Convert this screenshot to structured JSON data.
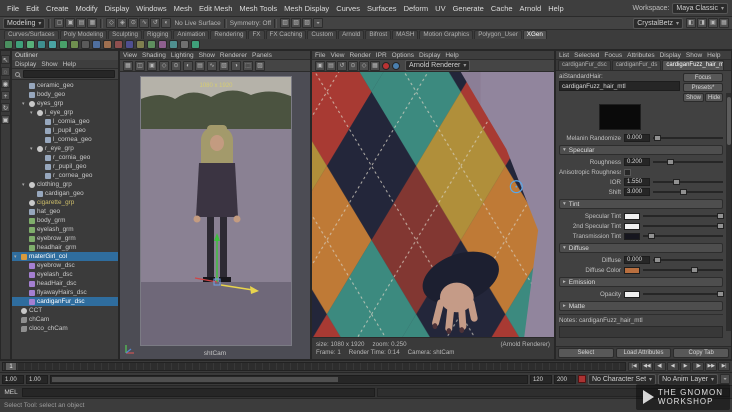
{
  "icons": {
    "caret_down": "▾",
    "caret_right": "▸"
  },
  "menubar": {
    "items": [
      "File",
      "Edit",
      "Create",
      "Modify",
      "Display",
      "Windows",
      "Mesh",
      "Edit Mesh",
      "Mesh Tools",
      "Mesh Display",
      "Curves",
      "Surfaces",
      "Deform",
      "UV",
      "Generate",
      "Cache",
      "Arnold",
      "Help"
    ],
    "workspace_label": "Workspace:",
    "workspace_value": "Maya Classic"
  },
  "statusline": {
    "mode": "Modeling",
    "icons1": [
      "▢",
      "▣",
      "▤",
      "▦"
    ],
    "icons2": [
      "◇",
      "◈",
      "⊙",
      "∿",
      "↺",
      "◐"
    ],
    "live_surface": "No Live Surface",
    "symmetry": "Symmetry: Off",
    "icons3": [
      "▥",
      "▧",
      "▨",
      "◒"
    ],
    "custom_menu": "CrystalBetz",
    "right_icons": [
      "◧",
      "◨",
      "▣",
      "▦"
    ]
  },
  "shelf": {
    "tabs": [
      {
        "label": "Curves/Surfaces"
      },
      {
        "label": "Poly Modeling"
      },
      {
        "label": "Sculpting"
      },
      {
        "label": "Rigging"
      },
      {
        "label": "Animation"
      },
      {
        "label": "Rendering"
      },
      {
        "label": "FX"
      },
      {
        "label": "FX Caching"
      },
      {
        "label": "Custom"
      },
      {
        "label": "Arnold"
      },
      {
        "label": "Bifrost"
      },
      {
        "label": "MASH"
      },
      {
        "label": "Motion Graphics"
      },
      {
        "label": "Polygon_User"
      },
      {
        "label": "XGen",
        "active": true
      }
    ],
    "icons": [
      {
        "color": "#4a8f5f"
      },
      {
        "color": "#3f9f7a"
      },
      {
        "color": "#58b07a"
      },
      {
        "color": "#3f8f8f"
      },
      {
        "color": "#4aa3a3"
      },
      {
        "color": "#49a06a"
      },
      {
        "color": "#6f8f4f"
      },
      {
        "color": "#5a5a5a"
      },
      {
        "color": "#4f6f9f"
      },
      {
        "color": "#9f6f4f"
      },
      {
        "color": "#8f4f4f"
      },
      {
        "color": "#4f4f8f"
      },
      {
        "color": "#7f7f4f"
      },
      {
        "color": "#5f8f5f"
      },
      {
        "color": "#8f5f8f"
      },
      {
        "color": "#4f8f8f"
      },
      {
        "color": "#6f6f6f"
      },
      {
        "color": "#3f9f7a"
      }
    ]
  },
  "toolbox": {
    "tools": [
      "↖",
      "◌",
      "◉",
      "+",
      "↻",
      "▣"
    ]
  },
  "outliner": {
    "title": "Outliner",
    "menus": [
      "Display",
      "Show",
      "Help"
    ],
    "items": [
      {
        "label": "ceramic_geo",
        "indent": 1,
        "icon": "geo"
      },
      {
        "label": "body_geo",
        "indent": 1,
        "icon": "geo"
      },
      {
        "label": "eyes_grp",
        "indent": 1,
        "icon": "grp",
        "caret": "▾"
      },
      {
        "label": "l_eye_grp",
        "indent": 2,
        "icon": "grp",
        "caret": "▾"
      },
      {
        "label": "l_cornia_geo",
        "indent": 3,
        "icon": "geo"
      },
      {
        "label": "l_pupil_geo",
        "indent": 3,
        "icon": "geo"
      },
      {
        "label": "l_cornea_geo",
        "indent": 3,
        "icon": "geo"
      },
      {
        "label": "r_eye_grp",
        "indent": 2,
        "icon": "grp",
        "caret": "▾"
      },
      {
        "label": "r_cornia_geo",
        "indent": 3,
        "icon": "geo"
      },
      {
        "label": "r_pupil_geo",
        "indent": 3,
        "icon": "geo"
      },
      {
        "label": "r_cornea_geo",
        "indent": 3,
        "icon": "geo"
      },
      {
        "label": "clothing_grp",
        "indent": 1,
        "icon": "grp",
        "caret": "▾"
      },
      {
        "label": "cardigan_geo",
        "indent": 2,
        "icon": "geo"
      },
      {
        "label": "cigarette_grp",
        "indent": 1,
        "icon": "grp",
        "cls": "ref"
      },
      {
        "label": "hat_geo",
        "indent": 1,
        "icon": "geo"
      },
      {
        "label": "body_grm",
        "indent": 1,
        "icon": "grm"
      },
      {
        "label": "eyelash_grm",
        "indent": 1,
        "icon": "grm"
      },
      {
        "label": "eyebrow_grm",
        "indent": 1,
        "icon": "grm"
      },
      {
        "label": "headhair_grm",
        "indent": 1,
        "icon": "grm"
      },
      {
        "label": "materGirl_col",
        "indent": 0,
        "icon": "col",
        "caret": "▾",
        "selected": true
      },
      {
        "label": "eyebrow_dsc",
        "indent": 1,
        "icon": "dsc"
      },
      {
        "label": "eyelash_dsc",
        "indent": 1,
        "icon": "dsc"
      },
      {
        "label": "headHair_dsc",
        "indent": 1,
        "icon": "dsc"
      },
      {
        "label": "flyawayHairs_dsc",
        "indent": 1,
        "icon": "dsc"
      },
      {
        "label": "cardiganFur_dsc",
        "indent": 1,
        "icon": "dsc",
        "selected": true
      },
      {
        "label": "CCT",
        "indent": 0,
        "icon": "grp"
      },
      {
        "label": "chCam",
        "indent": 0,
        "icon": "cam"
      },
      {
        "label": "cloco_chCam",
        "indent": 0,
        "icon": "cam"
      }
    ]
  },
  "viewport": {
    "menus": [
      "View",
      "Shading",
      "Lighting",
      "Show",
      "Renderer",
      "Panels"
    ],
    "toolbar_icons": [
      "▦",
      "◫",
      "▣",
      "◇",
      "⊙",
      "◐",
      "▤",
      "∿",
      "▧",
      "◑",
      "⬚",
      "▨"
    ],
    "resolution_label": "1080 x 1920",
    "camera_label": "shtCam"
  },
  "render_view": {
    "menus": [
      "File",
      "View",
      "Render",
      "IPR",
      "Options",
      "Display",
      "Help"
    ],
    "toolbar_icons": [
      "▣",
      "▤",
      "↺",
      "⊙",
      "◇",
      "▦"
    ],
    "renderer_label": "Arnold Renderer",
    "size_label": "size: 1080 x 1920",
    "zoom_label": "zoom: 0.250",
    "renderer_note": "(Arnold Renderer)",
    "frame_label": "Frame: 1",
    "render_time_label": "Render Time: 0:14",
    "camera_label": "Camera: shtCam"
  },
  "ae": {
    "menus": [
      "List",
      "Selected",
      "Focus",
      "Attributes",
      "Display",
      "Show",
      "Help"
    ],
    "tabs": [
      {
        "label": "cardiganFur_dsc"
      },
      {
        "label": "cardiganFur_ds"
      },
      {
        "label": "cardiganFuzz_hair_mtl",
        "active": true
      }
    ],
    "node_type_label": "aiStandardHair:",
    "node_name": "cardiganFuzz_hair_mtl",
    "focus_button": "Focus",
    "presets_button": "Presets*",
    "show_button": "Show",
    "hide_button": "Hide",
    "melanin_randomize_label": "Melanin Randomize",
    "melanin_randomize_value": "0.000",
    "specular_section": "Specular",
    "roughness_label": "Roughness",
    "roughness_value": "0.200",
    "aniso_label": "Anisotropic Roughness",
    "ior_label": "IOR",
    "ior_value": "1.550",
    "shift_label": "Shift",
    "shift_value": "3.000",
    "tint_section": "Tint",
    "spec_tint_label": "Specular Tint",
    "spec_tint_style": "background:#f0f0f0",
    "spec2_tint_label": "2nd Specular Tint",
    "spec2_tint_style": "background:#f0f0f0",
    "trans_tint_label": "Transmission Tint",
    "trans_tint_style": "background:#16161e",
    "diffuse_section": "Diffuse",
    "diffuse_label": "Diffuse",
    "diffuse_value": "0.000",
    "diffuse_color_label": "Diffuse Color",
    "diffuse_color_style": "background:#b96f3f",
    "emission_section": "Emission",
    "opacity_label": "Opacity",
    "opacity_style": "background:#f0f0f0",
    "matte_section": "Matte",
    "notes_label": "Notes: cardiganFuzz_hair_mtl",
    "select_button": "Select",
    "load_attributes_button": "Load Attributes",
    "copy_tab_button": "Copy Tab"
  },
  "timeline": {
    "current_frame": "1",
    "transport": [
      "|◀",
      "◀◀",
      "◀|",
      "◀",
      "▶",
      "|▶",
      "▶▶",
      "▶|"
    ],
    "playback_start": "1.00",
    "range_start": "1.00",
    "range_end": "120",
    "playback_end": "200",
    "character_set": "No Character Set",
    "anim_layer": "No Anim Layer"
  },
  "command_line": {
    "label": "MEL"
  },
  "help_line": {
    "text": "Select Tool: select an object"
  },
  "watermark": {
    "line1": "THE GNOMON",
    "line2": "WORKSHOP"
  }
}
